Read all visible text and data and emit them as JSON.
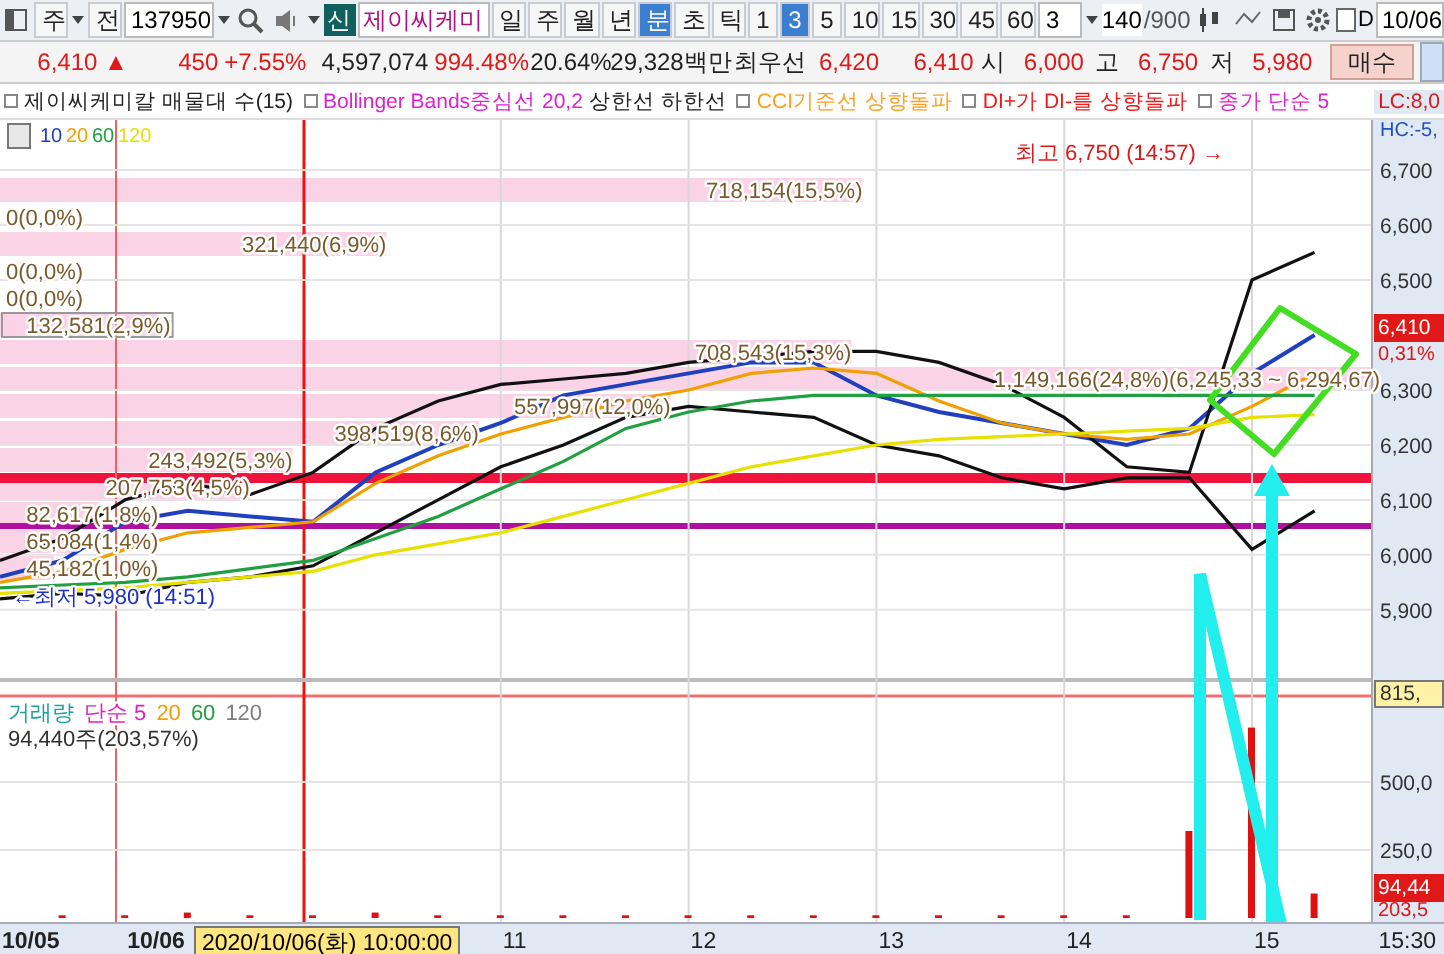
{
  "toolbar": {
    "market": "주",
    "prefix": "전",
    "code": "137950",
    "new_badge": "신",
    "name": "제이씨케미",
    "periods": [
      {
        "label": "일",
        "selected": false
      },
      {
        "label": "주",
        "selected": false
      },
      {
        "label": "월",
        "selected": false
      },
      {
        "label": "년",
        "selected": false
      },
      {
        "label": "분",
        "selected": true
      },
      {
        "label": "초",
        "selected": false
      },
      {
        "label": "틱",
        "selected": false
      }
    ],
    "intervals": [
      {
        "label": "1",
        "selected": false
      },
      {
        "label": "3",
        "selected": true
      },
      {
        "label": "5",
        "selected": false
      },
      {
        "label": "10",
        "selected": false
      },
      {
        "label": "15",
        "selected": false
      },
      {
        "label": "30",
        "selected": false
      },
      {
        "label": "45",
        "selected": false
      },
      {
        "label": "60",
        "selected": false
      }
    ],
    "count": "3",
    "range": "140",
    "range_max": "/900",
    "checkbox": {
      "label": "D",
      "checked": false
    },
    "date": "10/06"
  },
  "quote": [
    {
      "text": "6,410 ▲",
      "kind": "up"
    },
    {
      "text": "450",
      "kind": "up"
    },
    {
      "text": "+7.55%",
      "kind": "up"
    },
    {
      "text": "4,597,074",
      "kind": "plain"
    },
    {
      "text": "994.48%",
      "kind": "up"
    },
    {
      "text": "20.64%",
      "kind": "plain"
    },
    {
      "text": "29,328백만",
      "kind": "plain"
    },
    {
      "text": "최우선",
      "kind": "plain"
    },
    {
      "text": "6,420",
      "kind": "up"
    },
    {
      "text": "6,410",
      "kind": "up"
    },
    {
      "text": "시",
      "kind": "plain"
    },
    {
      "text": "6,000",
      "kind": "up"
    },
    {
      "text": "고",
      "kind": "plain"
    },
    {
      "text": "6,750",
      "kind": "up"
    },
    {
      "text": "저",
      "kind": "plain"
    },
    {
      "text": "5,980",
      "kind": "up"
    }
  ],
  "buy_button": "매수",
  "legend_before": [
    {
      "text": "제이씨케미칼 매물대 수(15)",
      "color": "#222222",
      "marker": true
    },
    {
      "text": "Bollinger Bands중심선 20,2",
      "color": "#e020d0",
      "marker": true
    }
  ],
  "legend_after": [
    {
      "text": "CCI기준선 상향돌파",
      "color": "#ffa020",
      "marker": true
    },
    {
      "text": "DI+가 DI-를 상향돌파",
      "color": "#f01818",
      "marker": true
    },
    {
      "text": "종가 단순 5",
      "color": "#e020d0",
      "marker": true
    }
  ],
  "lc": "LC:8,0",
  "hc": "HC:-5,",
  "volume_profile": [
    {
      "label": "718,154(15,5%)",
      "level": 0.625,
      "highlighted": false
    },
    {
      "label": "0(0,0%)",
      "highlighted": false
    },
    {
      "label": "321,440(6,9%)",
      "level": 0.28,
      "highlighted": false
    },
    {
      "label": "0(0,0%)",
      "highlighted": false
    },
    {
      "label": "0(0,0%)",
      "highlighted": false
    },
    {
      "label": "132,581(2,9%)",
      "level": 0.115,
      "highlighted": true
    },
    {
      "label": "708,543(15,3%)",
      "level": 0.617,
      "highlighted": false
    },
    {
      "label": "1,149,166(24,8%)(6,245,33 ~ 6,294,67)",
      "level": 1,
      "highlighted": false
    },
    {
      "label": "557,997(12,0%)",
      "level": 0.486,
      "highlighted": false
    },
    {
      "label": "398,519(8,6%)",
      "level": 0.347,
      "highlighted": false
    },
    {
      "label": "243,492(5,3%)",
      "level": 0.212,
      "highlighted": false
    },
    {
      "label": "207,753(4,5%)",
      "level": 0.181,
      "highlighted": false
    },
    {
      "label": "82,617(1,8%)",
      "level": 0.072,
      "highlighted": false
    },
    {
      "label": "65,084(1,4%)",
      "level": 0.057,
      "highlighted": false
    },
    {
      "label": "45,182(1,0%)",
      "level": 0.039,
      "highlighted": false
    }
  ],
  "price_chart": {
    "high_label": "최고 6,750 (14:57) →",
    "low_label": "←최저 5,980 (14:51)",
    "last_price": "6,410",
    "last_change": "0,31%",
    "chart_data": {
      "type": "line",
      "series": [
        {
          "name": "10",
          "color": "#2040c0",
          "values": [
            5960,
            5990,
            6060,
            6080,
            6070,
            6060,
            6150,
            6200,
            6240,
            6290,
            6310,
            6330,
            6350,
            6350,
            6290,
            6260,
            6240,
            6220,
            6200,
            6230,
            6330,
            6400
          ]
        },
        {
          "name": "상한선",
          "color": "#111111",
          "values": [
            5990,
            6030,
            6100,
            6130,
            6110,
            6150,
            6230,
            6280,
            6310,
            6320,
            6330,
            6350,
            6360,
            6370,
            6370,
            6350,
            6310,
            6250,
            6160,
            6150,
            6500,
            6550
          ]
        },
        {
          "name": "하한선",
          "color": "#111111",
          "values": [
            5920,
            5930,
            5925,
            5950,
            5960,
            5980,
            6040,
            6100,
            6160,
            6200,
            6250,
            6270,
            6260,
            6250,
            6200,
            6180,
            6140,
            6120,
            6140,
            6140,
            6010,
            6080
          ]
        },
        {
          "name": "20",
          "color": "#f0a000",
          "values": [
            5950,
            5970,
            6010,
            6040,
            6050,
            6060,
            6130,
            6180,
            6220,
            6250,
            6280,
            6300,
            6330,
            6340,
            6330,
            6280,
            6240,
            6220,
            6210,
            6220,
            6270,
            6330
          ]
        },
        {
          "name": "60",
          "color": "#20a040",
          "values": [
            5940,
            5945,
            5950,
            5960,
            5975,
            5990,
            6030,
            6070,
            6120,
            6170,
            6230,
            6260,
            6280,
            6290,
            6290,
            6290,
            6290,
            6290,
            6290,
            6290,
            6290,
            6290
          ]
        },
        {
          "name": "120",
          "color": "#e8e000",
          "values": [
            5930,
            5935,
            5940,
            5950,
            5960,
            5970,
            6000,
            6020,
            6040,
            6070,
            6100,
            6130,
            6160,
            6180,
            6200,
            6210,
            6215,
            6220,
            6225,
            6230,
            6250,
            6255
          ]
        }
      ],
      "grid": true,
      "ylim": [
        5776,
        6791
      ],
      "yticks": [
        {
          "value": 5900,
          "label": "5,900"
        },
        {
          "value": 6000,
          "label": "6,000"
        },
        {
          "value": 6100,
          "label": "6,100"
        },
        {
          "value": 6200,
          "label": "6,200"
        },
        {
          "value": 6300,
          "label": "6,300"
        },
        {
          "value": 6500,
          "label": "6,500"
        },
        {
          "value": 6600,
          "label": "6,600"
        },
        {
          "value": 6700,
          "label": "6,700"
        }
      ]
    }
  },
  "volume_legend": [
    {
      "text": "단순 5",
      "color": "#e020c0"
    },
    {
      "text": "20",
      "color": "#f0a000"
    },
    {
      "text": "60",
      "color": "#20a040"
    },
    {
      "text": "120",
      "color": "#808080"
    }
  ],
  "volume_reading": "94,440주(203,57%)",
  "volume_chart": {
    "max_label": "815,",
    "last_volume": "94,44",
    "last_ratio": "203,5",
    "chart_data": {
      "type": "bar",
      "categories": [
        "10/05",
        null,
        "10/06",
        null,
        null,
        null,
        null,
        null,
        "11",
        null,
        null,
        "12",
        null,
        null,
        "13",
        null,
        null,
        "14",
        null,
        null,
        "15",
        null
      ],
      "series": [
        {
          "name": "거래량",
          "color": "#e01010",
          "values": [
            0,
            10,
            10,
            20,
            10,
            10,
            20,
            10,
            10,
            10,
            10,
            10,
            10,
            10,
            10,
            10,
            10,
            10,
            10,
            320,
            700,
            90
          ]
        }
      ],
      "grid": true,
      "ylim": [
        0,
        875
      ],
      "yticks": [
        {
          "value": 250,
          "label": "250,0"
        },
        {
          "value": 500,
          "label": "500,0"
        }
      ]
    }
  },
  "crosshair_time": "2020/10/06(화) 10:00:00",
  "clock": "15:30"
}
